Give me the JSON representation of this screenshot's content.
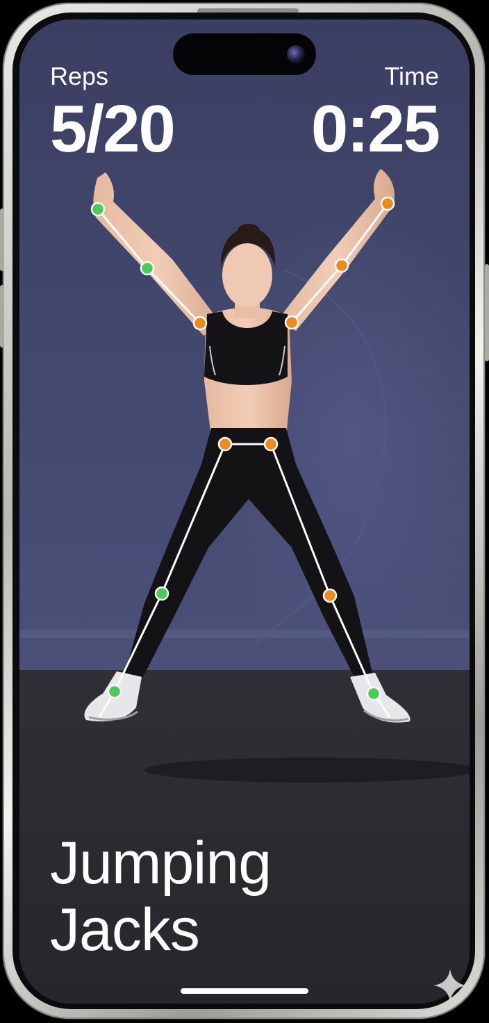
{
  "hud": {
    "reps_label": "Reps",
    "reps_value": "5/20",
    "time_label": "Time",
    "time_value": "0:25"
  },
  "exercise": {
    "title_line1": "Jumping",
    "title_line2": "Jacks"
  },
  "colors": {
    "background_wall": "#3f4568",
    "floor": "#2d2d32",
    "joint_green": "#4cc95a",
    "joint_orange": "#f08a1c",
    "skeleton_line": "#ffffff",
    "text": "#ffffff"
  },
  "icons": {
    "watermark": "sparkle-icon",
    "camera": "front-camera-icon"
  }
}
